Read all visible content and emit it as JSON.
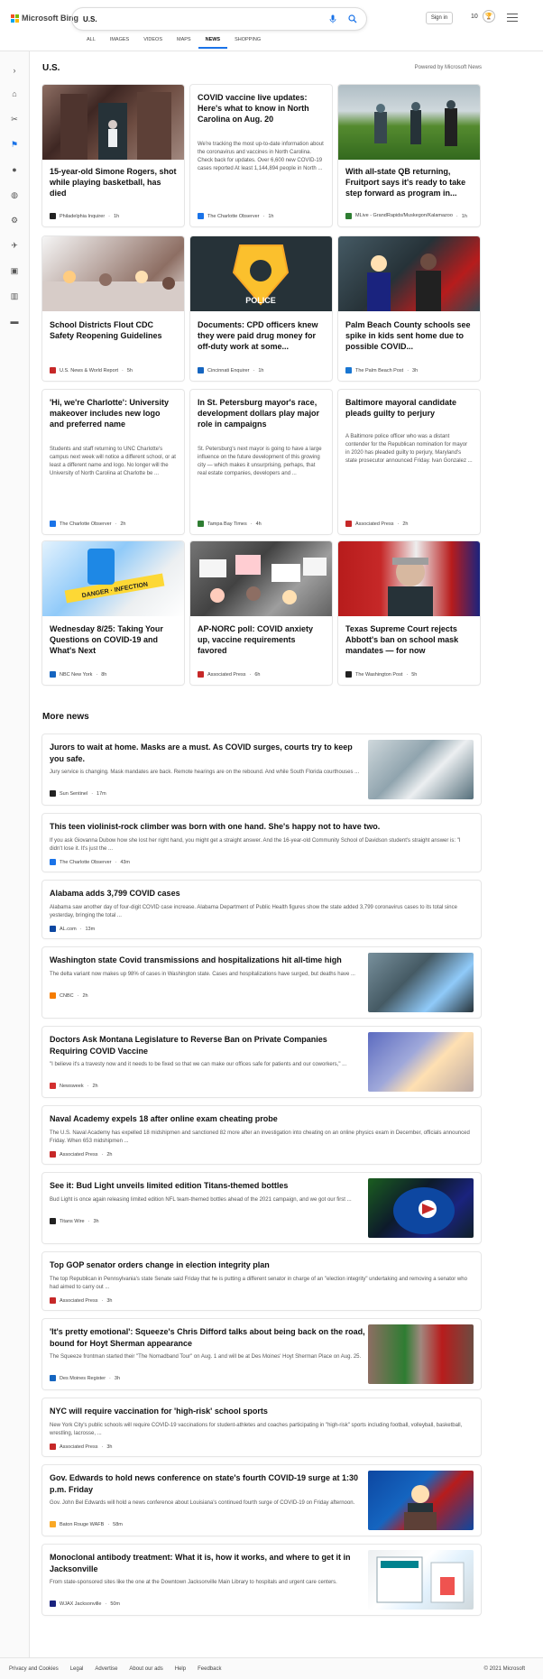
{
  "brand": {
    "name": "Microsoft Bing",
    "colors": [
      "#f25022",
      "#7fba00",
      "#00a4ef",
      "#ffb900"
    ]
  },
  "search": {
    "query": "U.S."
  },
  "header": {
    "signin_label": "Sign in",
    "points": "10"
  },
  "nav": [
    "ALL",
    "IMAGES",
    "VIDEOS",
    "MAPS",
    "NEWS",
    "SHOPPING"
  ],
  "section": {
    "title": "U.S.",
    "powered_by": "Powered by Microsoft News"
  },
  "cards": [
    {
      "title": "15-year-old Simone Rogers, shot while playing basketball, has died",
      "snippet": "",
      "source": "Philadelphia Inquirer",
      "time": "1h",
      "has_image": true,
      "fav_color": "#222"
    },
    {
      "title": "COVID vaccine live updates: Here's what to know in North Carolina on Aug. 20",
      "snippet": "We're tracking the most up-to-date information about the coronavirus and vaccines in North Carolina. Check back for updates. Over 6,600 new COVID-19 cases reported At least 1,144,894 people in North ...",
      "source": "The Charlotte Observer",
      "time": "1h",
      "has_image": false,
      "fav_color": "#1a73e8"
    },
    {
      "title": "With all-state QB returning, Fruitport says it's ready to take step forward as program in...",
      "snippet": "",
      "source": "MLive - GrandRapids/Muskegon/Kalamazoo",
      "time": "1h",
      "has_image": true,
      "fav_color": "#2e7d32"
    },
    {
      "title": "School Districts Flout CDC Safety Reopening Guidelines",
      "snippet": "",
      "source": "U.S. News & World Report",
      "time": "5h",
      "has_image": true,
      "fav_color": "#c62828"
    },
    {
      "title": "Documents: CPD officers knew they were paid drug money for off-duty work at some...",
      "snippet": "",
      "source": "Cincinnati Enquirer",
      "time": "1h",
      "has_image": true,
      "fav_color": "#1565c0"
    },
    {
      "title": "Palm Beach County schools see spike in kids sent home due to possible COVID...",
      "snippet": "",
      "source": "The Palm Beach Post",
      "time": "3h",
      "has_image": true,
      "fav_color": "#1976d2"
    },
    {
      "title": "'Hi, we're Charlotte': University makeover includes new logo and preferred name",
      "snippet": "Students and staff returning to UNC Charlotte's campus next week will notice a different school, or at least a different name and logo. No longer will the University of North Carolina at Charlotte be ...",
      "source": "The Charlotte Observer",
      "time": "2h",
      "has_image": false,
      "fav_color": "#1a73e8"
    },
    {
      "title": "In St. Petersburg mayor's race, development dollars play major role in campaigns",
      "snippet": "St. Petersburg's next mayor is going to have a large influence on the future development of this growing city — which makes it unsurprising, perhaps, that real estate companies, developers and ...",
      "source": "Tampa Bay Times",
      "time": "4h",
      "has_image": false,
      "fav_color": "#2e7d32"
    },
    {
      "title": "Baltimore mayoral candidate pleads guilty to perjury",
      "snippet": "A Baltimore police officer who was a distant contender for the Republican nomination for mayor in 2020 has pleaded guilty to perjury, Maryland's state prosecutor announced Friday. Ivan Gonzalez ...",
      "source": "Associated Press",
      "time": "2h",
      "has_image": false,
      "fav_color": "#c62828"
    },
    {
      "title": "Wednesday 8/25: Taking Your Questions on COVID-19 and What's Next",
      "snippet": "",
      "source": "NBC New York",
      "time": "8h",
      "has_image": true,
      "fav_color": "#1565c0"
    },
    {
      "title": "AP-NORC poll: COVID anxiety up, vaccine requirements favored",
      "snippet": "",
      "source": "Associated Press",
      "time": "6h",
      "has_image": true,
      "fav_color": "#c62828"
    },
    {
      "title": "Texas Supreme Court rejects Abbott's ban on school mask mandates — for now",
      "snippet": "",
      "source": "The Washington Post",
      "time": "5h",
      "has_image": true,
      "fav_color": "#222"
    }
  ],
  "more_news": {
    "title": "More news",
    "items": [
      {
        "title": "Jurors to wait at home. Masks are a must. As COVID surges, courts try to keep you safe.",
        "snippet": "Jury service is changing. Mask mandates are back. Remote hearings are on the rebound. And while South Florida courthouses ...",
        "source": "Sun Sentinel",
        "time": "17m",
        "thumb": true,
        "fav_color": "#222"
      },
      {
        "title": "This teen violinist-rock climber was born with one hand. She's happy not to have two.",
        "snippet": "If you ask Giovanna Dubow how she lost her right hand, you might get a straight answer. And the 16-year-old Community School of Davidson student's straight answer is: \"I didn't lose it. It's just the ...",
        "source": "The Charlotte Observer",
        "time": "43m",
        "thumb": false,
        "fav_color": "#1a73e8"
      },
      {
        "title": "Alabama adds 3,799 COVID cases",
        "snippet": "Alabama saw another day of four-digit COVID case increase. Alabama Department of Public Health figures show the state added 3,799 coronavirus cases to its total since yesterday, bringing the total ...",
        "source": "AL.com",
        "time": "13m",
        "thumb": false,
        "fav_color": "#0d47a1"
      },
      {
        "title": "Washington state Covid transmissions and hospitalizations hit all-time high",
        "snippet": "The delta variant now makes up 98% of cases in Washington state. Cases and hospitalizations have surged, but deaths have ...",
        "source": "CNBC",
        "time": "2h",
        "thumb": true,
        "fav_color": "#f57c00"
      },
      {
        "title": "Doctors Ask Montana Legislature to Reverse Ban on Private Companies Requiring COVID Vaccine",
        "snippet": "\"I believe it's a travesty now and it needs to be fixed so that we can make our offices safe for patients and our coworkers,\" ...",
        "source": "Newsweek",
        "time": "2h",
        "thumb": true,
        "fav_color": "#d32f2f"
      },
      {
        "title": "Naval Academy expels 18 after online exam cheating probe",
        "snippet": "The U.S. Naval Academy has expelled 18 midshipmen and sanctioned 82 more after an investigation into cheating on an online physics exam in December, officials announced Friday. When 653 midshipmen ...",
        "source": "Associated Press",
        "time": "2h",
        "thumb": false,
        "fav_color": "#c62828"
      },
      {
        "title": "See it: Bud Light unveils limited edition Titans-themed bottles",
        "snippet": "Bud Light is once again releasing limited edition NFL team-themed bottles ahead of the 2021 campaign, and we got our first ...",
        "source": "Titans Wire",
        "time": "3h",
        "thumb": true,
        "fav_color": "#222"
      },
      {
        "title": "Top GOP senator orders change in election integrity plan",
        "snippet": "The top Republican in Pennsylvania's state Senate said Friday that he is putting a different senator in charge of an \"election integrity\" undertaking and removing a senator who had aimed to carry out ...",
        "source": "Associated Press",
        "time": "3h",
        "thumb": false,
        "fav_color": "#c62828"
      },
      {
        "title": "'It's pretty emotional': Squeeze's Chris Difford talks about being back on the road, bound for Hoyt Sherman appearance",
        "snippet": "The Squeeze frontman started their \"The Nomadband Tour\" on Aug. 1 and will be at Des Moines' Hoyt Sherman Place on Aug. 25.",
        "source": "Des Moines Register",
        "time": "3h",
        "thumb": true,
        "fav_color": "#1565c0"
      },
      {
        "title": "NYC will require vaccination for 'high-risk' school sports",
        "snippet": "New York City's public schools will require COVID-19 vaccinations for student-athletes and coaches participating in \"high-risk\" sports including football, volleyball, basketball, wrestling, lacrosse, ...",
        "source": "Associated Press",
        "time": "3h",
        "thumb": false,
        "fav_color": "#c62828"
      },
      {
        "title": "Gov. Edwards to hold news conference on state's fourth COVID-19 surge at 1:30 p.m. Friday",
        "snippet": "Gov. John Bel Edwards will hold a news conference about Louisiana's continued fourth surge of COVID-19 on Friday afternoon.",
        "source": "Baton Rouge WAFB",
        "time": "58m",
        "thumb": true,
        "fav_color": "#f9a825"
      },
      {
        "title": "Monoclonal antibody treatment: What it is, how it works, and where to get it in Jacksonville",
        "snippet": "From state-sponsored sites like the one at the Downtown Jacksonville Main Library to hospitals and urgent care centers.",
        "source": "WJAX Jacksonville",
        "time": "50m",
        "thumb": true,
        "fav_color": "#1a237e"
      }
    ]
  },
  "footer": {
    "links": [
      "Privacy and Cookies",
      "Legal",
      "Advertise",
      "About our ads",
      "Help",
      "Feedback"
    ],
    "copyright": "© 2021 Microsoft"
  }
}
